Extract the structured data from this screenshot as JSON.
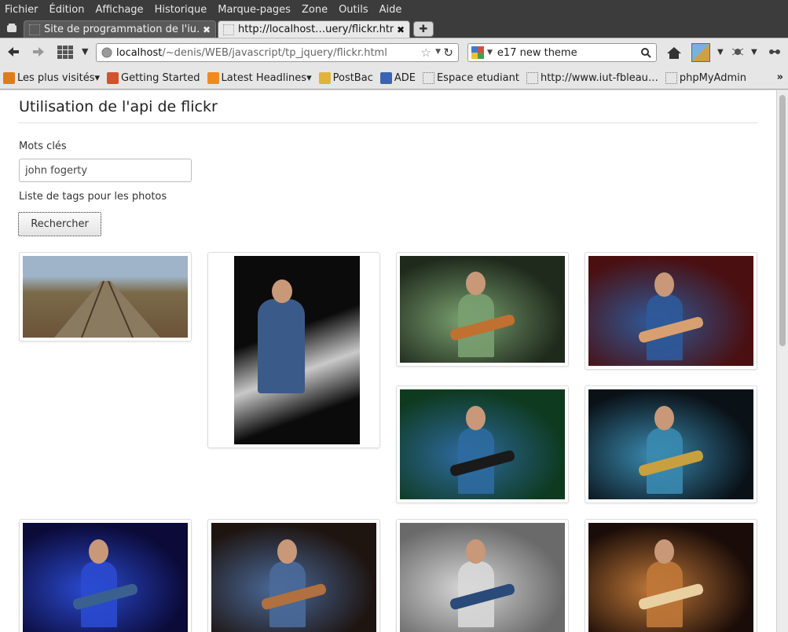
{
  "menubar": {
    "items": [
      "Fichier",
      "Édition",
      "Affichage",
      "Historique",
      "Marque-pages",
      "Zone",
      "Outils",
      "Aide"
    ]
  },
  "tabs": [
    {
      "title": "Site de programmation de l'iu…",
      "active": false
    },
    {
      "title": "http://localhost…uery/flickr.html",
      "active": true
    }
  ],
  "navbar": {
    "url_host": "localhost",
    "url_path": "/~denis/WEB/javascript/tp_jquery/flickr.html",
    "search_value": "e17 new theme"
  },
  "bookmarks": [
    {
      "label": "Les plus visités",
      "icon": "most-visited-icon",
      "dropdown": true,
      "color": "#e07b1a"
    },
    {
      "label": "Getting Started",
      "icon": "firefox-icon",
      "dropdown": false,
      "color": "#d3522a"
    },
    {
      "label": "Latest Headlines",
      "icon": "rss-icon",
      "dropdown": true,
      "color": "#f18a1e"
    },
    {
      "label": "PostBac",
      "icon": "postbac-icon",
      "dropdown": false,
      "color": "#e2b33a"
    },
    {
      "label": "ADE",
      "icon": "ade-icon",
      "dropdown": false,
      "color": "#3a63b5"
    },
    {
      "label": "Espace etudiant",
      "icon": "page-icon",
      "dropdown": false,
      "color": ""
    },
    {
      "label": "http://www.iut-fbleau…",
      "icon": "page-icon",
      "dropdown": false,
      "color": ""
    },
    {
      "label": "phpMyAdmin",
      "icon": "page-icon",
      "dropdown": false,
      "color": ""
    }
  ],
  "page": {
    "title": "Utilisation de l'api de flickr",
    "keywords_label": "Mots clés",
    "keywords_value": "john fogerty",
    "tags_label": "Liste de tags pour les photos",
    "search_button": "Rechercher"
  },
  "photos": [
    {
      "alt": "railway-tracks-autumn",
      "colors": [
        "#9fb4c8",
        "#7a6a4a",
        "#6b5338"
      ]
    },
    {
      "alt": "guitarist-on-stage",
      "colors": [
        "#0b0b0b",
        "#3a5a8a",
        "#c9c9c9"
      ]
    },
    {
      "alt": "concert-green-stage",
      "colors": [
        "#1f2a1c",
        "#7aa070",
        "#c07030"
      ]
    },
    {
      "alt": "two-guitarists-red",
      "colors": [
        "#4a0f10",
        "#2f5a9a",
        "#d8a070"
      ]
    },
    {
      "alt": "guitarist-green-light",
      "colors": [
        "#0e3a20",
        "#2e6aa0",
        "#1a1a1a"
      ]
    },
    {
      "alt": "guitarist-cyan-screen",
      "colors": [
        "#0a1218",
        "#3a8ab0",
        "#c8a040"
      ]
    },
    {
      "alt": "singer-blue-light",
      "colors": [
        "#0b0a38",
        "#2a4ad0",
        "#3a6090"
      ]
    },
    {
      "alt": "duo-guitarists",
      "colors": [
        "#1e1410",
        "#4a6a9a",
        "#b07040"
      ]
    },
    {
      "alt": "guitarist-grey-backdrop",
      "colors": [
        "#6a6a6a",
        "#d8d8d8",
        "#2a4a7a"
      ]
    },
    {
      "alt": "full-band-stage",
      "colors": [
        "#1a0c08",
        "#c07838",
        "#e8d0a0"
      ]
    }
  ]
}
